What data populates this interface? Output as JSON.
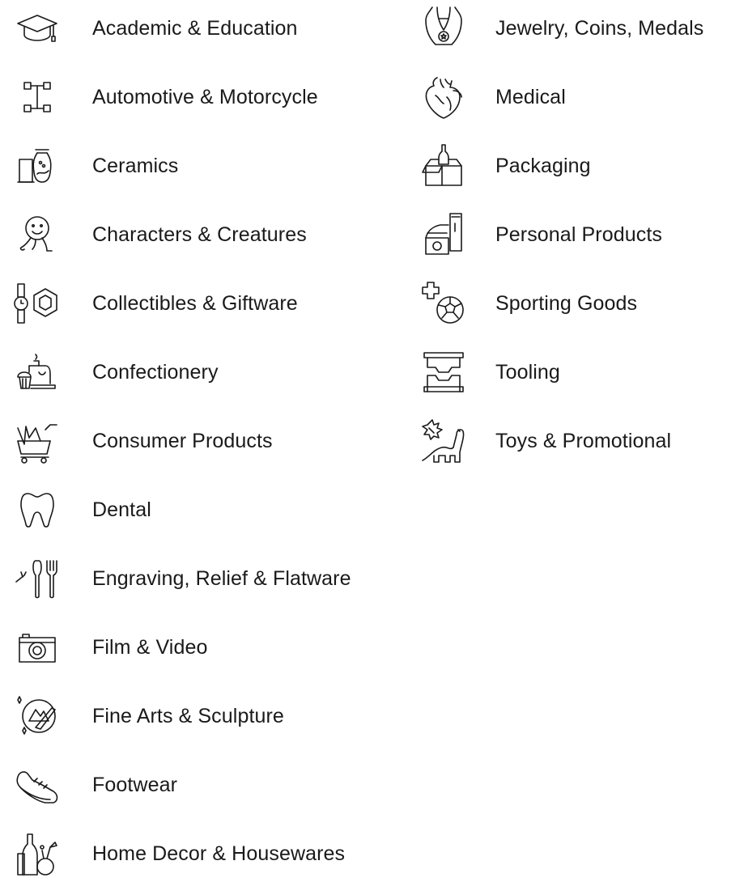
{
  "categories": {
    "left": [
      {
        "label": "Academic & Education",
        "icon": "graduation-cap-icon"
      },
      {
        "label": "Automotive & Motorcycle",
        "icon": "chassis-icon"
      },
      {
        "label": "Ceramics",
        "icon": "vases-icon"
      },
      {
        "label": "Characters & Creatures",
        "icon": "character-icon"
      },
      {
        "label": "Collectibles & Giftware",
        "icon": "watch-hexagon-icon"
      },
      {
        "label": "Confectionery",
        "icon": "cake-icon"
      },
      {
        "label": "Consumer Products",
        "icon": "shopping-cart-icon"
      },
      {
        "label": "Dental",
        "icon": "tooth-icon"
      },
      {
        "label": "Engraving, Relief & Flatware",
        "icon": "cutlery-icon"
      },
      {
        "label": "Film & Video",
        "icon": "camera-icon"
      },
      {
        "label": "Fine Arts & Sculpture",
        "icon": "palette-icon"
      },
      {
        "label": "Footwear",
        "icon": "sneaker-icon"
      },
      {
        "label": "Home Decor & Housewares",
        "icon": "bottles-icon"
      }
    ],
    "right": [
      {
        "label": "Jewelry, Coins, Medals",
        "icon": "necklace-icon"
      },
      {
        "label": "Medical",
        "icon": "heart-organ-icon"
      },
      {
        "label": "Packaging",
        "icon": "box-bottle-icon"
      },
      {
        "label": "Personal Products",
        "icon": "cosmetics-icon"
      },
      {
        "label": "Sporting Goods",
        "icon": "soccer-ball-icon"
      },
      {
        "label": "Tooling",
        "icon": "mold-icon"
      },
      {
        "label": "Toys & Promotional",
        "icon": "dinosaur-icon"
      }
    ]
  }
}
